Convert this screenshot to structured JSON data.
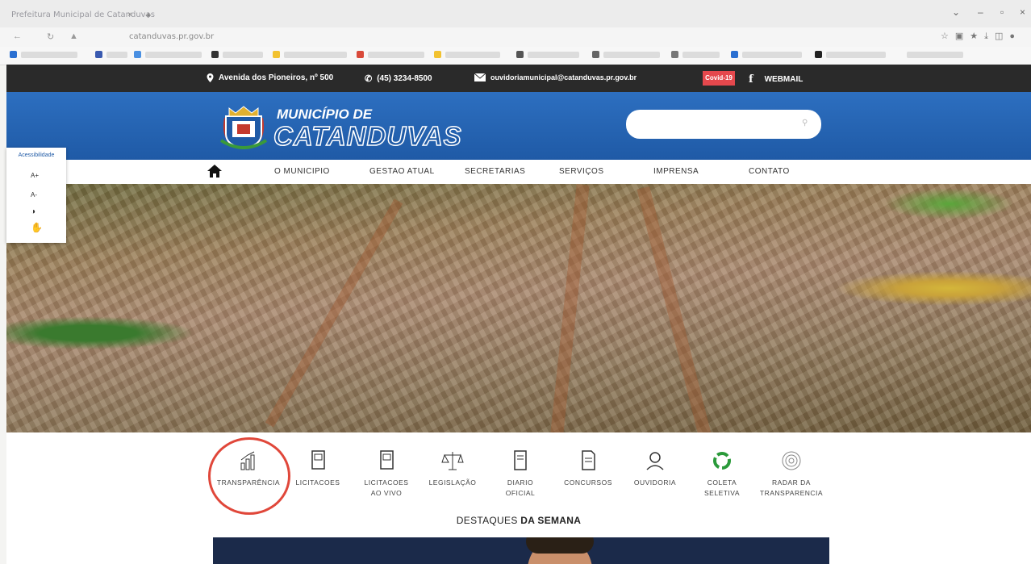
{
  "browser": {
    "tab_title": "Prefeitura Municipal de Catanduvas",
    "url": "catanduvas.pr.gov.br"
  },
  "topbar": {
    "address": "Avenida dos Pioneiros, nº 500",
    "phone": "(45) 3234-8500",
    "email": "ouvidoriamunicipal@catanduvas.pr.gov.br",
    "covid_label": "Covid-19",
    "webmail_label": "WEBMAIL"
  },
  "header": {
    "logo_line1": "MUNICÍPIO DE",
    "logo_line2": "CATANDUVAS",
    "search_placeholder": ""
  },
  "accessibility": {
    "title": "Acessibilidade",
    "items": [
      "A+",
      "A-",
      "",
      ""
    ]
  },
  "nav": {
    "items": [
      "O MUNICIPIO",
      "GESTAO ATUAL",
      "SECRETARIAS",
      "SERVIÇOS",
      "IMPRENSA",
      "CONTATO"
    ]
  },
  "quick_links": [
    {
      "line1": "TRANSPARÊNCIA",
      "line2": "",
      "icon": "chart-bar-icon"
    },
    {
      "line1": "LICITACOES",
      "line2": "",
      "icon": "book-icon"
    },
    {
      "line1": "LICITACOES",
      "line2": "AO VIVO",
      "icon": "book-live-icon"
    },
    {
      "line1": "LEGISLAÇÃO",
      "line2": "",
      "icon": "scales-icon"
    },
    {
      "line1": "DIARIO",
      "line2": "OFICIAL",
      "icon": "newspaper-icon"
    },
    {
      "line1": "CONCURSOS",
      "line2": "",
      "icon": "document-icon"
    },
    {
      "line1": "OUVIDORIA",
      "line2": "",
      "icon": "headset-icon"
    },
    {
      "line1": "COLETA",
      "line2": "SELETIVA",
      "icon": "recycle-icon"
    },
    {
      "line1": "RADAR DA",
      "line2": "TRANSPARENCIA",
      "icon": "radar-icon"
    }
  ],
  "section": {
    "title_a": "DESTAQUES",
    "title_b": "DA SEMANA"
  },
  "colors": {
    "header_blue": "#1f5aa6",
    "topbar": "#2a2a2a",
    "covid_red": "#e5484d",
    "highlight_circle": "#e0473a"
  }
}
